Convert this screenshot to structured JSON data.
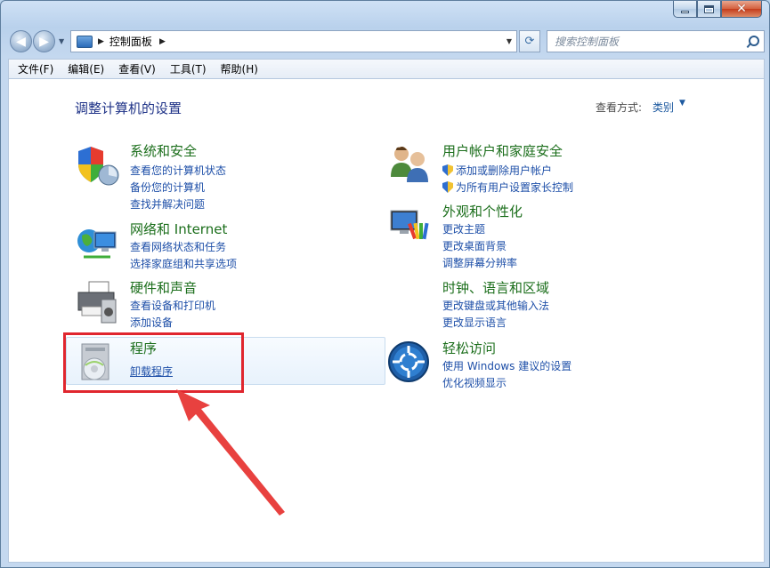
{
  "window": {
    "caption_buttons": [
      "minimize",
      "maximize",
      "close"
    ]
  },
  "address_bar": {
    "path": "控制面板",
    "search_placeholder": "搜索控制面板"
  },
  "menu": [
    "文件(F)",
    "编辑(E)",
    "查看(V)",
    "工具(T)",
    "帮助(H)"
  ],
  "page": {
    "title": "调整计算机的设置",
    "view_by_label": "查看方式:",
    "view_by_value": "类别"
  },
  "categories": [
    {
      "id": "system-security",
      "icon": "shield-monitor-icon",
      "title": "系统和安全",
      "links": [
        "查看您的计算机状态",
        "备份您的计算机",
        "查找并解决问题"
      ]
    },
    {
      "id": "network-internet",
      "icon": "globe-network-icon",
      "title": "网络和 Internet",
      "links": [
        "查看网络状态和任务",
        "选择家庭组和共享选项"
      ]
    },
    {
      "id": "hardware-sound",
      "icon": "printer-icon",
      "title": "硬件和声音",
      "links": [
        "查看设备和打印机",
        "添加设备"
      ]
    },
    {
      "id": "programs",
      "icon": "programs-disc-icon",
      "title": "程序",
      "links": [
        "卸载程序"
      ]
    },
    {
      "id": "user-accounts",
      "icon": "users-icon",
      "title": "用户帐户和家庭安全",
      "links": [
        "添加或删除用户帐户",
        "为所有用户设置家长控制"
      ]
    },
    {
      "id": "appearance",
      "icon": "palette-monitor-icon",
      "title": "外观和个性化",
      "links": [
        "更改主题",
        "更改桌面背景",
        "调整屏幕分辨率"
      ]
    },
    {
      "id": "clock-language",
      "icon": "clock-globe-icon",
      "title": "时钟、语言和区域",
      "links": [
        "更改键盘或其他输入法",
        "更改显示语言"
      ]
    },
    {
      "id": "ease-of-access",
      "icon": "ease-of-access-icon",
      "title": "轻松访问",
      "links": [
        "使用 Windows 建议的设置",
        "优化视频显示"
      ]
    }
  ],
  "annotation": {
    "highlight_color": "#e0262e"
  }
}
